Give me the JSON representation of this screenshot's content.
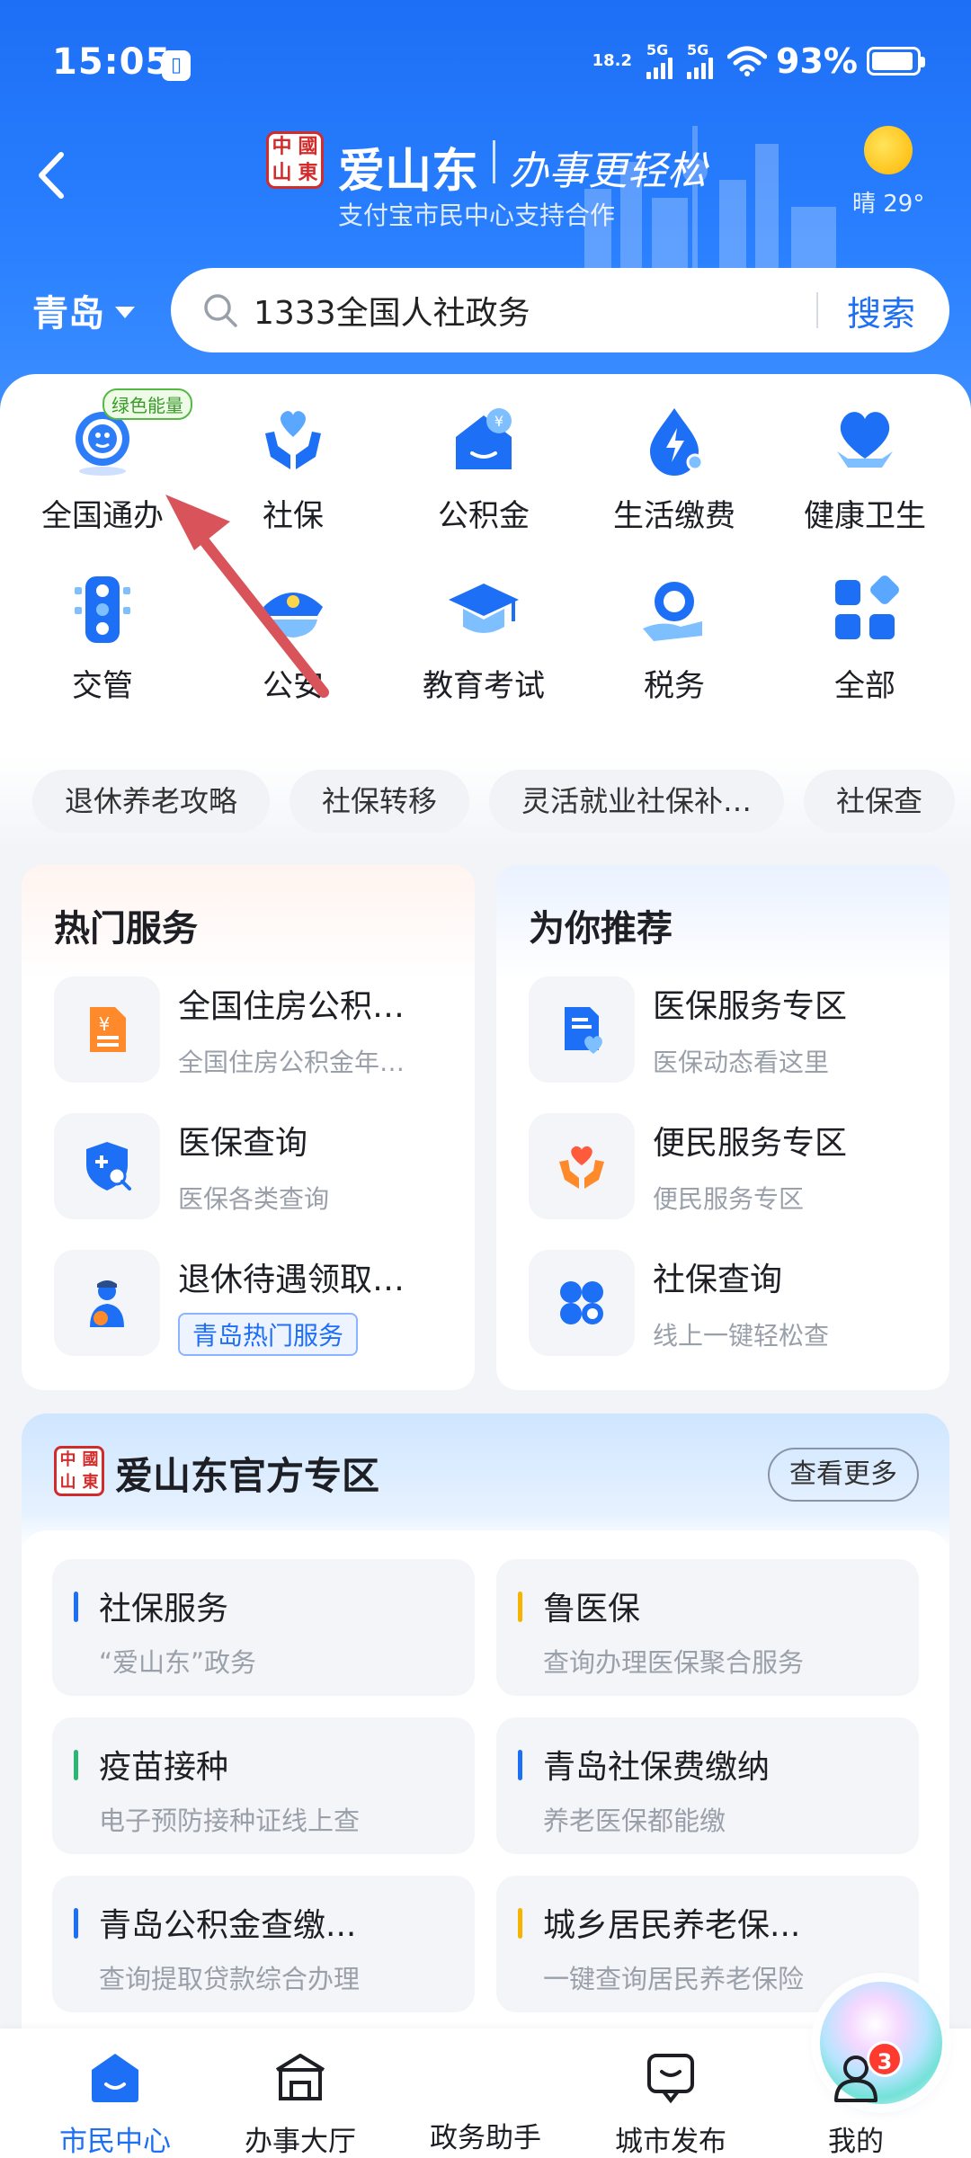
{
  "status_bar": {
    "time": "15:05",
    "lock_glyph": "🔒",
    "speed_value": "18.2",
    "signal1_label": "5G",
    "signal2_label": "5G",
    "battery_percent": "93%",
    "battery_level": 0.93
  },
  "header": {
    "brand_logo_chars": [
      "中",
      "國",
      "山",
      "東"
    ],
    "brand_name": "爱山东",
    "slogan": "办事更轻松",
    "subtitle": "支付宝市民中心支持合作",
    "weather": "晴 29°"
  },
  "location": {
    "city": "青岛"
  },
  "search": {
    "query": "1333全国人社政务",
    "button_label": "搜索"
  },
  "services": [
    {
      "label": "全国通办",
      "icon": "globe-icon",
      "badge": "绿色能量"
    },
    {
      "label": "社保",
      "icon": "heart-hands-icon"
    },
    {
      "label": "公积金",
      "icon": "house-coin-icon"
    },
    {
      "label": "生活缴费",
      "icon": "lightning-drop-icon"
    },
    {
      "label": "健康卫生",
      "icon": "health-heart-icon"
    },
    {
      "label": "交管",
      "icon": "traffic-light-icon"
    },
    {
      "label": "公安",
      "icon": "police-cap-icon"
    },
    {
      "label": "教育考试",
      "icon": "graduation-cap-icon"
    },
    {
      "label": "税务",
      "icon": "tax-icon"
    },
    {
      "label": "全部",
      "icon": "grid-all-icon"
    }
  ],
  "chips": [
    "退休养老攻略",
    "社保转移",
    "灵活就业社保补…",
    "社保查"
  ],
  "hot_services": {
    "title": "热门服务",
    "items": [
      {
        "title": "全国住房公积…",
        "subtitle": "全国住房公积金年…"
      },
      {
        "title": "医保查询",
        "subtitle": "医保各类查询"
      },
      {
        "title": "退休待遇领取…",
        "tag": "青岛热门服务"
      }
    ]
  },
  "recommend": {
    "title": "为你推荐",
    "items": [
      {
        "title": "医保服务专区",
        "subtitle": "医保动态看这里"
      },
      {
        "title": "便民服务专区",
        "subtitle": "便民服务专区"
      },
      {
        "title": "社保查询",
        "subtitle": "线上一键轻松查"
      }
    ]
  },
  "official_zone": {
    "title": "爱山东官方专区",
    "more_label": "查看更多",
    "items": [
      {
        "title": "社保服务",
        "subtitle": "“爱山东”政务",
        "accent": "#1d6ff5"
      },
      {
        "title": "鲁医保",
        "subtitle": "查询办理医保聚合服务",
        "accent": "#f5b400"
      },
      {
        "title": "疫苗接种",
        "subtitle": "电子预防接种证线上查",
        "accent": "#2bb673"
      },
      {
        "title": "青岛社保费缴纳",
        "subtitle": "养老医保都能缴",
        "accent": "#1d6ff5"
      },
      {
        "title": "青岛公积金查缴...",
        "subtitle": "查询提取贷款综合办理",
        "accent": "#1d6ff5"
      },
      {
        "title": "城乡居民养老保...",
        "subtitle": "一键查询居民养老保险",
        "accent": "#f5b400"
      }
    ]
  },
  "bottom_nav": {
    "items": [
      {
        "label": "市民中心",
        "active": true
      },
      {
        "label": "办事大厅"
      },
      {
        "label": "政务助手"
      },
      {
        "label": "城市发布"
      },
      {
        "label": "我的",
        "badge": "3"
      }
    ]
  },
  "colors": {
    "primary": "#1d6ff5",
    "accent_red": "#d12b2b",
    "badge_red": "#ff3b30"
  }
}
